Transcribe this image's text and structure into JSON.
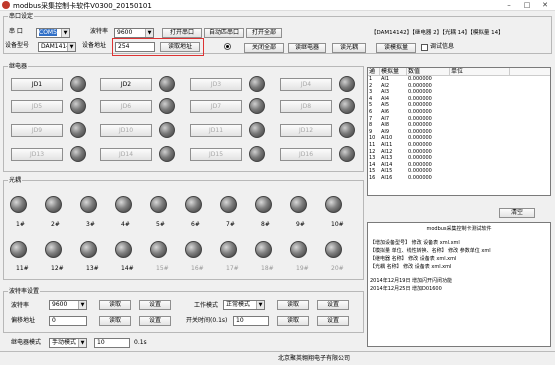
{
  "window": {
    "title": "modbus采集控制卡软件V0300_20150101"
  },
  "serial": {
    "group_title": "串口设定",
    "port_label": "串 口",
    "port_value": "COM5",
    "baud_label": "波特率",
    "baud_value": "9600",
    "open_btn": "打开串口",
    "auto_btn": "自动匹串口",
    "open_all_btn": "打开全部",
    "model_label": "设备型号",
    "model_value": "DAM14142",
    "addr_label": "设备地址",
    "addr_value": "254",
    "read_addr_btn": "读取地址",
    "close_all_btn": "关闭全部",
    "read_relay_btn": "读继电器",
    "read_opto_btn": "读光耦",
    "read_analog_btn": "读模拟量",
    "debug_label": "调试信息",
    "info_text": "【DAM14142】【继电器 2】【光耦 14】【模拟量 14】"
  },
  "relay": {
    "group_title": "继电器",
    "buttons": [
      "JD1",
      "JD2",
      "JD3",
      "JD4",
      "JD5",
      "JD6",
      "JD7",
      "JD8",
      "JD9",
      "JD10",
      "JD11",
      "JD12",
      "JD13",
      "JD14",
      "JD15",
      "JD16"
    ]
  },
  "opto": {
    "group_title": "光耦",
    "labels": [
      "1#",
      "2#",
      "3#",
      "4#",
      "5#",
      "6#",
      "7#",
      "8#",
      "9#",
      "10#",
      "11#",
      "12#",
      "13#",
      "14#",
      "15#",
      "16#",
      "17#",
      "18#",
      "19#",
      "20#"
    ]
  },
  "table": {
    "headers": [
      "通",
      "模拟量",
      "数值",
      "单位"
    ],
    "rows": [
      [
        "1",
        "AI1",
        "0.000000",
        ""
      ],
      [
        "2",
        "AI2",
        "0.000000",
        ""
      ],
      [
        "3",
        "AI3",
        "0.000000",
        ""
      ],
      [
        "4",
        "AI4",
        "0.000000",
        ""
      ],
      [
        "5",
        "AI5",
        "0.000000",
        ""
      ],
      [
        "6",
        "AI6",
        "0.000000",
        ""
      ],
      [
        "7",
        "AI7",
        "0.000000",
        ""
      ],
      [
        "8",
        "AI8",
        "0.000000",
        ""
      ],
      [
        "9",
        "AI9",
        "0.000000",
        ""
      ],
      [
        "10",
        "AI10",
        "0.000000",
        ""
      ],
      [
        "11",
        "AI11",
        "0.000000",
        ""
      ],
      [
        "12",
        "AI12",
        "0.000000",
        ""
      ],
      [
        "13",
        "AI13",
        "0.000000",
        ""
      ],
      [
        "14",
        "AI14",
        "0.000000",
        ""
      ],
      [
        "15",
        "AI15",
        "0.000000",
        ""
      ],
      [
        "16",
        "AI16",
        "0.000000",
        ""
      ]
    ]
  },
  "log": {
    "clear_btn": "清空",
    "lines": [
      "modbus采集控制卡测试软件",
      "【增加设备型号】 修改 设备表 xml.xml",
      "【模拟量 单位、线性转换、名称】 修改 参数单位 xml",
      "【继电器 名称】 修改 设备表 xml.xml",
      "【光耦 名称】 修改 设备表 xml.xml",
      "2014年12月19日  增加闪开闪闭功能",
      "2014年12月25日  增加D01600"
    ]
  },
  "baudset": {
    "group_title": "波特率设置",
    "baud_label": "波特率",
    "baud_value": "9600",
    "read_btn": "读取",
    "set_btn": "设置",
    "offset_label": "偏移地址",
    "offset_value": "0",
    "read_btn2": "读取",
    "set_btn2": "设置",
    "mode_label": "工作模式",
    "mode_value": "正常模式",
    "read_btn3": "读取",
    "set_btn3": "设置",
    "switch_label": "开关时间(0.1s)",
    "switch_value": "10",
    "read_btn4": "读取",
    "set_btn4": "设置",
    "relay_mode_label": "继电器模式",
    "relay_mode_value": "手动模式",
    "relay_time_value": "10",
    "relay_time_unit": "0.1s"
  },
  "status": {
    "company": "北京聚英翱翔电子有限公司"
  }
}
